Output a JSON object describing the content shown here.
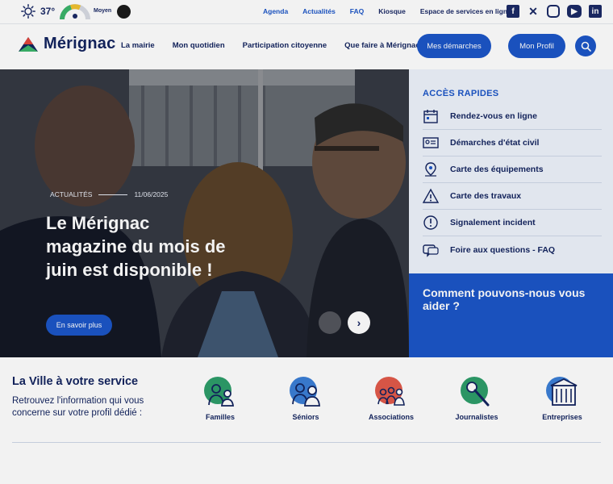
{
  "topbar": {
    "temperature": "37°",
    "air_quality": "Moyen",
    "links": [
      {
        "label": "Agenda",
        "accent": true
      },
      {
        "label": "Actualités",
        "accent": true
      },
      {
        "label": "FAQ",
        "accent": true
      },
      {
        "label": "Kiosque",
        "accent": false
      },
      {
        "label": "Espace de services en ligne",
        "accent": false
      }
    ],
    "socials": [
      "facebook-icon",
      "x-icon",
      "instagram-icon",
      "youtube-icon",
      "linkedin-icon"
    ]
  },
  "header": {
    "logo": "Mérignac",
    "nav": [
      "La mairie",
      "Mon quotidien",
      "Participation citoyenne",
      "Que faire à Mérignac ?"
    ],
    "demarches_label": "Mes démarches",
    "profil_label": "Mon Profil"
  },
  "hero": {
    "category": "ACTUALITÉS",
    "date": "11/06/2025",
    "title": "Le Mérignac magazine du mois de juin est disponible !",
    "cta": "En savoir plus"
  },
  "quick_access": {
    "title": "ACCÈS RAPIDES",
    "items": [
      {
        "label": "Rendez-vous en ligne",
        "icon": "calendar-icon"
      },
      {
        "label": "Démarches d'état civil",
        "icon": "id-card-icon"
      },
      {
        "label": "Carte des équipements",
        "icon": "map-pin-icon"
      },
      {
        "label": "Carte des travaux",
        "icon": "warning-icon"
      },
      {
        "label": "Signalement incident",
        "icon": "alert-icon"
      },
      {
        "label": "Foire aux questions - FAQ",
        "icon": "chat-icon"
      }
    ]
  },
  "help": {
    "title": "Comment pouvons-nous vous aider ?"
  },
  "services": {
    "title": "La Ville à votre service",
    "text": "Retrouvez l'information qui vous concerne sur votre profil dédié :",
    "profiles": [
      {
        "label": "Familles",
        "color": "#2e9e6a"
      },
      {
        "label": "Séniors",
        "color": "#3b7fd6"
      },
      {
        "label": "Associations",
        "color": "#e25a4a"
      },
      {
        "label": "Journalistes",
        "color": "#2e9e6a"
      },
      {
        "label": "Entreprises",
        "color": "#3b7fd6"
      }
    ]
  },
  "colors": {
    "primary": "#1c56c8",
    "navy": "#13245f",
    "panel": "#eef3fb"
  }
}
